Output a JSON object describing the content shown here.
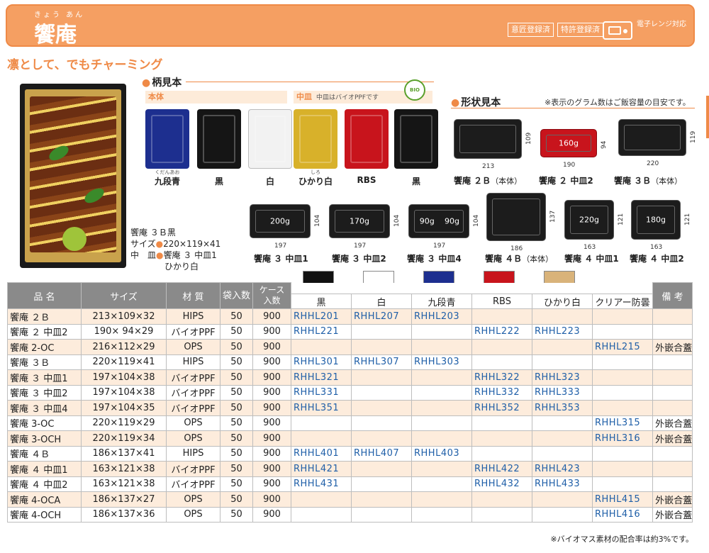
{
  "header": {
    "ruby": "きょう あん",
    "title": "饗庵",
    "badge1": "意匠登録済",
    "badge2": "特許登録済",
    "microwave": "電子レンジ対応"
  },
  "catch": "凛として、でもチャーミング",
  "product_caption": {
    "name": "饗庵 ３Ｂ黒",
    "size_label": "サイズ",
    "size": "220×119×41",
    "mid_label": "中　皿",
    "mid": "饗庵 ３ 中皿1",
    "mid_color": "ひかり白"
  },
  "pattern_section": {
    "title": "柄見本",
    "body_label": "本体",
    "mid_label": "中皿",
    "mid_note": "中皿はバイオPPFです",
    "body_colors": [
      {
        "ruby": "くだんあお",
        "label": "九段青",
        "color": "#1d2f8f"
      },
      {
        "ruby": "",
        "label": "黒",
        "color": "#151515"
      },
      {
        "ruby": "",
        "label": "白",
        "color": "#f2f2f2"
      }
    ],
    "mid_colors": [
      {
        "ruby": "しろ",
        "label": "ひかり白",
        "color": "#d8b12a"
      },
      {
        "ruby": "",
        "label": "RBS",
        "color": "#c8141c"
      },
      {
        "ruby": "",
        "label": "黒",
        "color": "#151515"
      }
    ]
  },
  "shape_section": {
    "title": "形状見本",
    "note": "※表示のグラム数はご飯容量の目安です。",
    "shapes": [
      {
        "name": "饗庵 ２Ｂ",
        "sub": "（本体）",
        "w": "213",
        "h": "109",
        "grams": ""
      },
      {
        "name": "饗庵 ２ 中皿2",
        "sub": "",
        "w": "190",
        "h": "94",
        "grams": "160g"
      },
      {
        "name": "饗庵 ３Ｂ",
        "sub": "（本体）",
        "w": "220",
        "h": "119",
        "grams": ""
      },
      {
        "name": "饗庵 ３ 中皿1",
        "sub": "",
        "w": "197",
        "h": "104",
        "grams": "200g"
      },
      {
        "name": "饗庵 ３ 中皿2",
        "sub": "",
        "w": "197",
        "h": "104",
        "grams": "170g"
      },
      {
        "name": "饗庵 ３ 中皿4",
        "sub": "",
        "w": "197",
        "h": "104",
        "grams": "90g"
      },
      {
        "name": "饗庵 ４Ｂ",
        "sub": "（本体）",
        "w": "186",
        "h": "137",
        "grams": ""
      },
      {
        "name": "饗庵 ４ 中皿1",
        "sub": "",
        "w": "163",
        "h": "121",
        "grams": "220g"
      },
      {
        "name": "饗庵 ４ 中皿2",
        "sub": "",
        "w": "163",
        "h": "121",
        "grams": "180g"
      }
    ]
  },
  "table": {
    "headers": {
      "name": "品 名",
      "size": "サイズ",
      "material": "材 質",
      "bag": "袋入数",
      "case": "ケース入数",
      "notes": "備 考"
    },
    "color_headers": [
      "黒",
      "白",
      "九段青",
      "RBS",
      "ひかり白",
      "クリアー防曇"
    ],
    "rows": [
      {
        "name": "饗庵 ２Ｂ",
        "size": "213×109×32",
        "mat": "HIPS",
        "bag": "50",
        "case": "900",
        "c": [
          "RHHL201",
          "RHHL207",
          "RHHL203",
          "",
          "",
          ""
        ],
        "note": ""
      },
      {
        "name": "饗庵 ２ 中皿2",
        "size": "190× 94×29",
        "mat": "バイオPPF",
        "bag": "50",
        "case": "900",
        "c": [
          "RHHL221",
          "",
          "",
          "RHHL222",
          "RHHL223",
          ""
        ],
        "note": ""
      },
      {
        "name": "饗庵 2-OC",
        "size": "216×112×29",
        "mat": "OPS",
        "bag": "50",
        "case": "900",
        "c": [
          "",
          "",
          "",
          "",
          "",
          "RHHL215"
        ],
        "note": "外嵌合蓋"
      },
      {
        "name": "饗庵 ３Ｂ",
        "size": "220×119×41",
        "mat": "HIPS",
        "bag": "50",
        "case": "900",
        "c": [
          "RHHL301",
          "RHHL307",
          "RHHL303",
          "",
          "",
          ""
        ],
        "note": ""
      },
      {
        "name": "饗庵 ３ 中皿1",
        "size": "197×104×38",
        "mat": "バイオPPF",
        "bag": "50",
        "case": "900",
        "c": [
          "RHHL321",
          "",
          "",
          "RHHL322",
          "RHHL323",
          ""
        ],
        "note": ""
      },
      {
        "name": "饗庵 ３ 中皿2",
        "size": "197×104×38",
        "mat": "バイオPPF",
        "bag": "50",
        "case": "900",
        "c": [
          "RHHL331",
          "",
          "",
          "RHHL332",
          "RHHL333",
          ""
        ],
        "note": ""
      },
      {
        "name": "饗庵 ３ 中皿4",
        "size": "197×104×35",
        "mat": "バイオPPF",
        "bag": "50",
        "case": "900",
        "c": [
          "RHHL351",
          "",
          "",
          "RHHL352",
          "RHHL353",
          ""
        ],
        "note": ""
      },
      {
        "name": "饗庵 3-OC",
        "size": "220×119×29",
        "mat": "OPS",
        "bag": "50",
        "case": "900",
        "c": [
          "",
          "",
          "",
          "",
          "",
          "RHHL315"
        ],
        "note": "外嵌合蓋"
      },
      {
        "name": "饗庵 3-OCH",
        "size": "220×119×34",
        "mat": "OPS",
        "bag": "50",
        "case": "900",
        "c": [
          "",
          "",
          "",
          "",
          "",
          "RHHL316"
        ],
        "note": "外嵌合蓋"
      },
      {
        "name": "饗庵 ４Ｂ",
        "size": "186×137×41",
        "mat": "HIPS",
        "bag": "50",
        "case": "900",
        "c": [
          "RHHL401",
          "RHHL407",
          "RHHL403",
          "",
          "",
          ""
        ],
        "note": ""
      },
      {
        "name": "饗庵 ４ 中皿1",
        "size": "163×121×38",
        "mat": "バイオPPF",
        "bag": "50",
        "case": "900",
        "c": [
          "RHHL421",
          "",
          "",
          "RHHL422",
          "RHHL423",
          ""
        ],
        "note": ""
      },
      {
        "name": "饗庵 ４ 中皿2",
        "size": "163×121×38",
        "mat": "バイオPPF",
        "bag": "50",
        "case": "900",
        "c": [
          "RHHL431",
          "",
          "",
          "RHHL432",
          "RHHL433",
          ""
        ],
        "note": ""
      },
      {
        "name": "饗庵 4-OCA",
        "size": "186×137×27",
        "mat": "OPS",
        "bag": "50",
        "case": "900",
        "c": [
          "",
          "",
          "",
          "",
          "",
          "RHHL415"
        ],
        "note": "外嵌合蓋"
      },
      {
        "name": "饗庵 4-OCH",
        "size": "186×137×36",
        "mat": "OPS",
        "bag": "50",
        "case": "900",
        "c": [
          "",
          "",
          "",
          "",
          "",
          "RHHL416"
        ],
        "note": "外嵌合蓋"
      }
    ]
  },
  "swatches": [
    {
      "name": "black",
      "color": "#111111"
    },
    {
      "name": "white",
      "color": "#ffffff"
    },
    {
      "name": "kudan-blue",
      "color": "#1d2f8f"
    },
    {
      "name": "rbs",
      "color": "#c8141c"
    },
    {
      "name": "hikari-white",
      "color": "#d9b37a"
    }
  ],
  "footnote": "※バイオマス素材の配合率は約3%です。"
}
